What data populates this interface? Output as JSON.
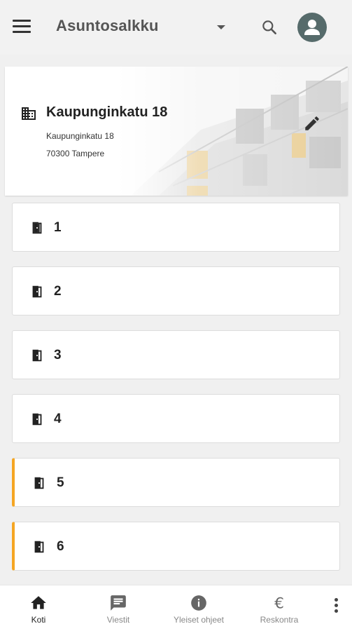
{
  "appbar": {
    "title": "Asuntosalkku",
    "menu_icon": "menu-icon",
    "dropdown_icon": "arrow-drop-down-icon",
    "search_icon": "search-icon",
    "avatar_icon": "account-icon",
    "avatar_color": "#566b6b"
  },
  "property": {
    "name": "Kaupunginkatu 18",
    "street": "Kaupunginkatu 18",
    "postal_city": "70300 Tampere",
    "icon": "building-icon",
    "edit_icon": "edit-pencil-icon"
  },
  "apartments": [
    {
      "label": "1",
      "icon": "door-icon",
      "accent": false
    },
    {
      "label": "2",
      "icon": "door-icon",
      "accent": false
    },
    {
      "label": "3",
      "icon": "door-icon",
      "accent": false
    },
    {
      "label": "4",
      "icon": "door-icon",
      "accent": false
    },
    {
      "label": "5",
      "icon": "door-icon",
      "accent": true
    },
    {
      "label": "6",
      "icon": "door-icon",
      "accent": true
    }
  ],
  "accent_color": "#f5a623",
  "bottom_nav": {
    "items": [
      {
        "label": "Koti",
        "icon": "home-icon",
        "active": true
      },
      {
        "label": "Viestit",
        "icon": "message-icon",
        "active": false
      },
      {
        "label": "Yleiset ohjeet",
        "icon": "info-icon",
        "active": false
      },
      {
        "label": "Reskontra",
        "icon": "euro-icon",
        "active": false
      }
    ],
    "more_icon": "more-vert-icon"
  }
}
